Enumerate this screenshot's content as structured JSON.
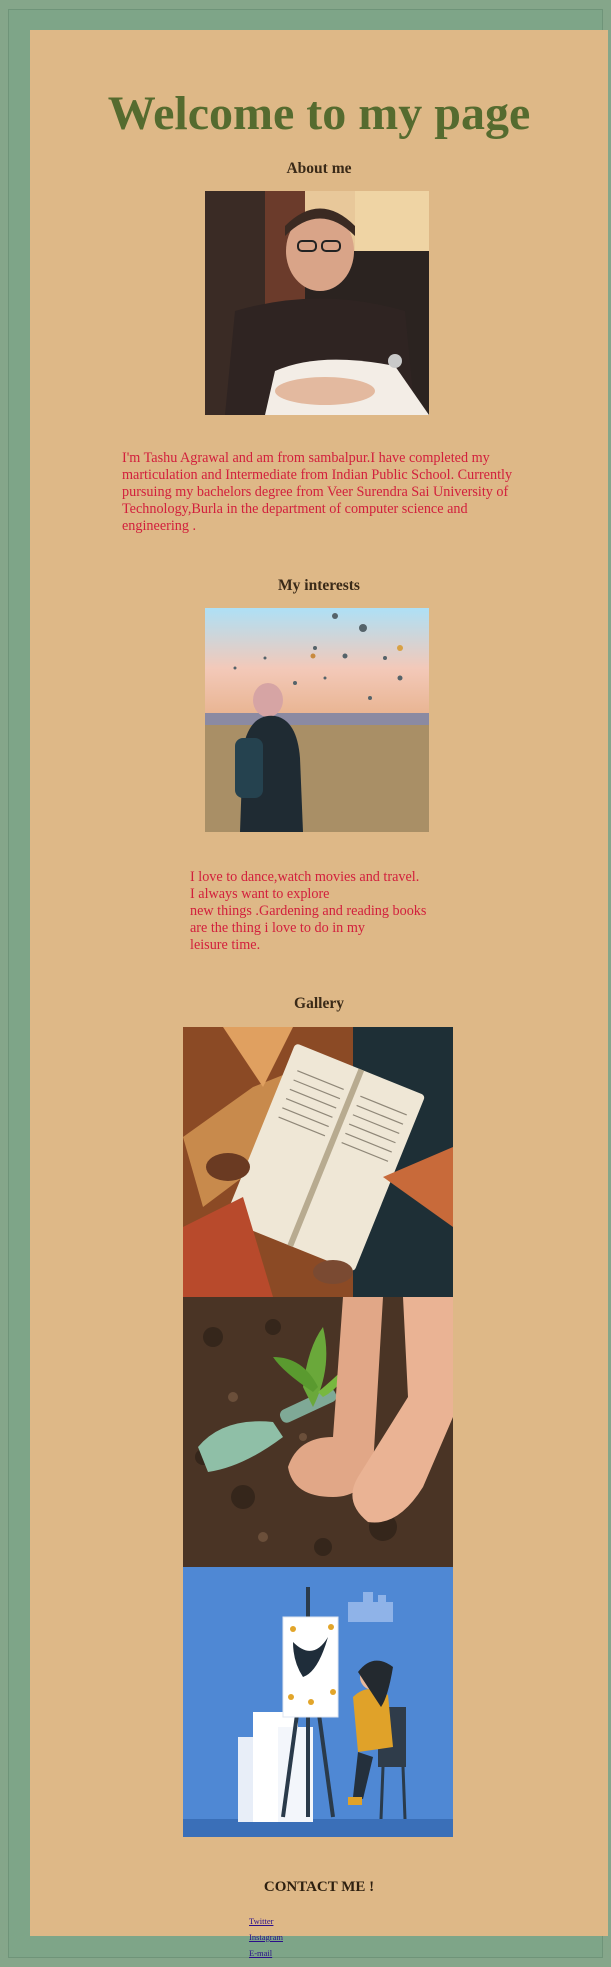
{
  "page": {
    "title": "Welcome to my page"
  },
  "about": {
    "heading": "About me",
    "photo_label": "portrait of a girl with glasses",
    "text": "I'm Tashu Agrawal and am from sambalpur.I have completed my marticulation and Intermediate from Indian Public School. Currently pursuing my bachelors degree from Veer Surendra Sai University of Technology,Burla in the department of computer science and engineering ."
  },
  "interests": {
    "heading": "My interests",
    "photo_label": "person watching hot air balloons",
    "lines": [
      "I love to dance,watch movies and travel.",
      "I always want to explore",
      "new things .Gardening and reading books",
      "are the thing i love to do in my",
      "leisure time."
    ]
  },
  "gallery": {
    "heading": "Gallery",
    "images": [
      "reading a book",
      "planting a seedling",
      "painting at an easel"
    ]
  },
  "contact": {
    "heading": "CONTACT ME !",
    "links": [
      "Twitter",
      "Instagram",
      "E-mail"
    ]
  },
  "colors": {
    "frame": "#7ea588",
    "panel": "#deb887",
    "title": "#556b2f",
    "text": "#d21f3c",
    "link": "#2a0e8a"
  }
}
